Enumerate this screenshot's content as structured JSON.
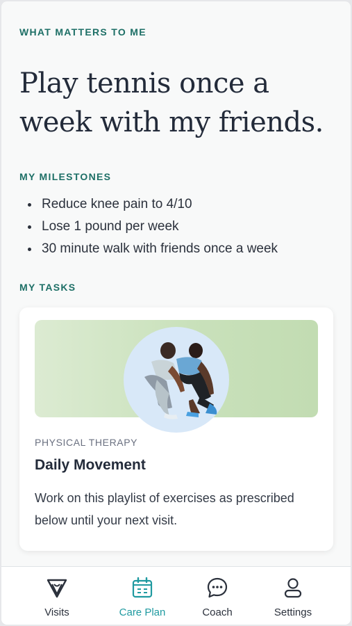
{
  "what_matters": {
    "label": "WHAT MATTERS TO ME",
    "goal": "Play tennis once a week with my friends."
  },
  "milestones": {
    "label": "MY MILESTONES",
    "items": [
      "Reduce knee pain to 4/10",
      "Lose 1 pound per week",
      "30 minute walk with friends once a week"
    ]
  },
  "tasks": {
    "label": "MY TASKS",
    "card": {
      "kicker": "PHYSICAL THERAPY",
      "title": "Daily Movement",
      "body": "Work on this playlist of exercises as prescribed below until your next visit.",
      "image": "two-people-stretching-photo"
    }
  },
  "tabbar": {
    "tabs": [
      {
        "label": "Visits",
        "icon": "visits-logo-icon",
        "active": false
      },
      {
        "label": "Care Plan",
        "icon": "calendar-icon",
        "active": true
      },
      {
        "label": "Coach",
        "icon": "chat-bubble-icon",
        "active": false
      },
      {
        "label": "Settings",
        "icon": "person-icon",
        "active": false
      }
    ]
  },
  "colors": {
    "accent_teal": "#1d6f66",
    "active_tab": "#1f9aa0",
    "text_dark": "#232b3a",
    "banner_green": "#c9e1bb",
    "photo_blue": "#d8e8f8"
  }
}
